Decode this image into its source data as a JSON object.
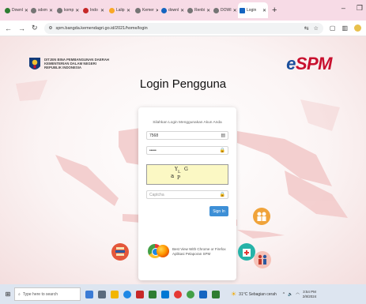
{
  "browser": {
    "tabs": [
      {
        "label": "Downl",
        "color": "#2e7d32"
      },
      {
        "label": "sdxm",
        "color": "#757575"
      },
      {
        "label": "komp",
        "color": "#757575"
      },
      {
        "label": "Indo",
        "color": "#c62828"
      },
      {
        "label": "Lalip",
        "color": "#f9a825"
      },
      {
        "label": "Kemer",
        "color": "#757575"
      },
      {
        "label": "downl",
        "color": "#1565c0"
      },
      {
        "label": "Renbi",
        "color": "#757575"
      },
      {
        "label": "DOWI",
        "color": "#757575"
      }
    ],
    "active_tab": {
      "label": "Login",
      "color": "#1565c0"
    },
    "new_tab": "+",
    "url": "spm.bangda.kemendagri.go.id/2021/home/login"
  },
  "page": {
    "org_lines": [
      "DITJEN BINA PEMBANGUNAN DAERAH",
      "KEMENTERIAN DALAM NEGERI",
      "REPUBLIK INDONESIA"
    ],
    "brand_e": "e",
    "brand_rest": "SPM",
    "title": "Login Pengguna",
    "login": {
      "hint": "Silahkan Login Menggunakan Akun Anda",
      "username_value": "7568",
      "password_value": "•••••",
      "captcha_chars": [
        "a",
        "Y",
        "L",
        "P",
        "G"
      ],
      "captcha_placeholder": "Captcha",
      "signin_label": "Sign In",
      "bestview_line1": "Best View With Chrome or Firefox",
      "bestview_line2": "Aplikasi Pelaporan SPM"
    }
  },
  "taskbar": {
    "search_placeholder": "Type here to search",
    "weather": "31°C  Sebagian cerah",
    "clock_time": "3:54 PM",
    "clock_date": "2/8/2024"
  }
}
